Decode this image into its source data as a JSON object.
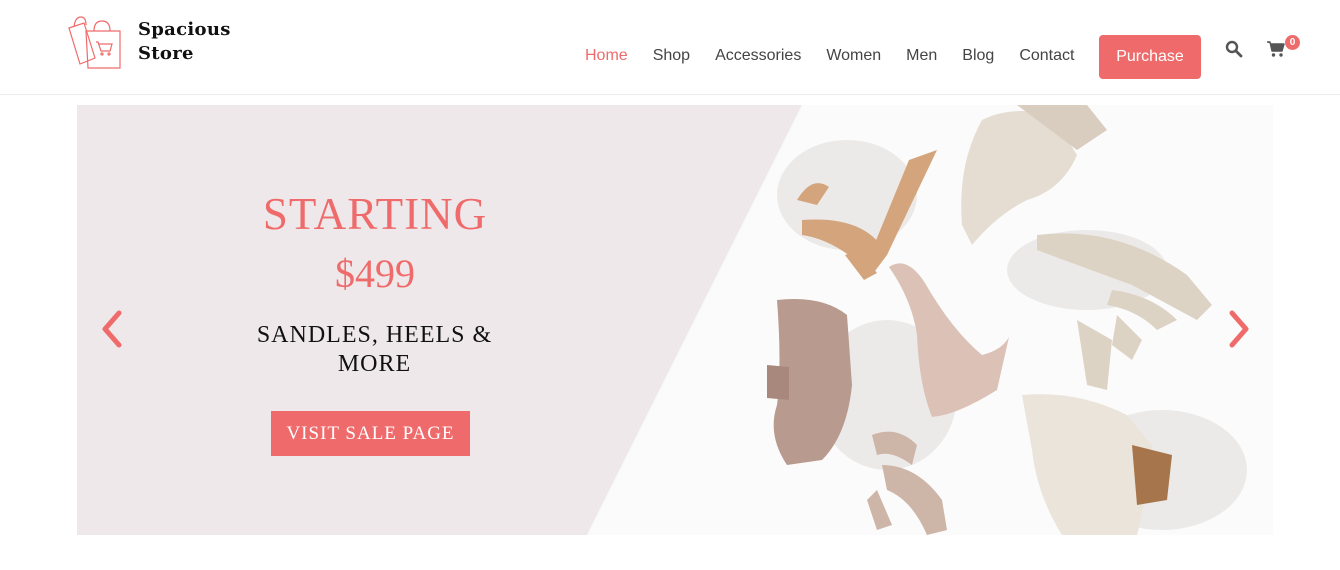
{
  "brand": {
    "line1": "Spacious",
    "line2": "Store"
  },
  "nav": {
    "items": [
      {
        "label": "Home",
        "active": true
      },
      {
        "label": "Shop",
        "active": false
      },
      {
        "label": "Accessories",
        "active": false
      },
      {
        "label": "Women",
        "active": false
      },
      {
        "label": "Men",
        "active": false
      },
      {
        "label": "Blog",
        "active": false
      },
      {
        "label": "Contact",
        "active": false
      }
    ]
  },
  "header": {
    "purchase_label": "Purchase",
    "search_icon": "search-icon",
    "cart_icon": "cart-icon",
    "cart_count": "0"
  },
  "hero": {
    "line1": "STARTING",
    "line2": "$499",
    "subtitle_line1": "SANDLES, HEELS &",
    "subtitle_line2": "MORE",
    "cta_label": "VISIT SALE PAGE",
    "prev_icon": "chevron-left-icon",
    "next_icon": "chevron-right-icon",
    "image": "shoes-photo"
  },
  "colors": {
    "accent": "#ef6b6b",
    "panel": "#efe8ea",
    "text": "#444444"
  }
}
